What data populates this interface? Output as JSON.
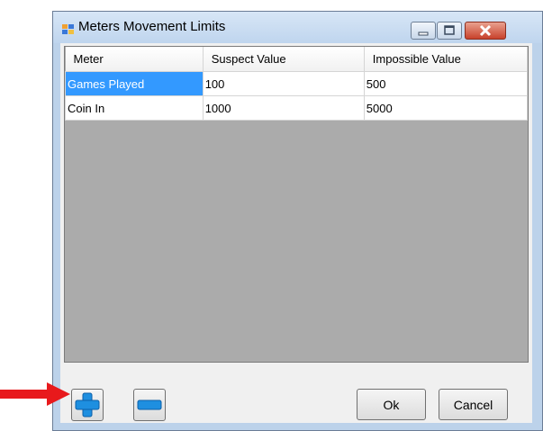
{
  "window": {
    "title": "Meters Movement Limits",
    "icon": "form-window-icon",
    "caption_buttons": [
      "minimize-icon",
      "maximize-icon",
      "close-icon"
    ]
  },
  "grid": {
    "columns": [
      "Meter",
      "Suspect Value",
      "Impossible Value"
    ],
    "rows": [
      {
        "meter": "Games Played",
        "suspect": "100",
        "impossible": "500",
        "selected": true
      },
      {
        "meter": "Coin In",
        "suspect": "1000",
        "impossible": "5000",
        "selected": false
      }
    ]
  },
  "buttons": {
    "add_icon": "plus-icon",
    "remove_icon": "minus-icon",
    "ok_label": "Ok",
    "cancel_label": "Cancel"
  },
  "annotation": {
    "arrow_color": "#e8191c"
  },
  "colors": {
    "selection": "#3399ff",
    "grid_background": "#ababab",
    "icon_blue": "#1e8fe0"
  }
}
